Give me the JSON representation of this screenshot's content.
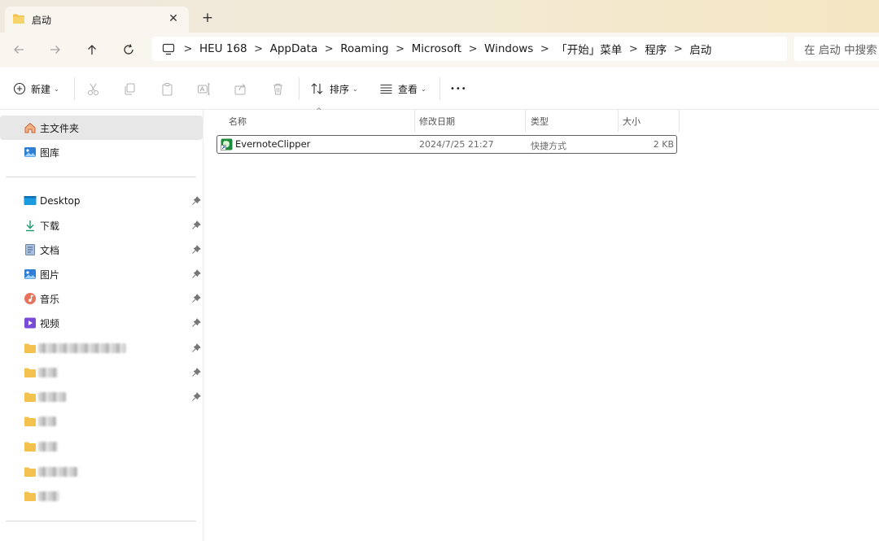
{
  "tab": {
    "title": "启动",
    "close": "✕",
    "new_tab": "+"
  },
  "address": {
    "crumbs": [
      "HEU 168",
      "AppData",
      "Roaming",
      "Microsoft",
      "Windows",
      "「开始」菜单",
      "程序",
      "启动"
    ],
    "separator": ">"
  },
  "search": {
    "placeholder": "在 启动 中搜索"
  },
  "toolbar": {
    "new_label": "新建",
    "sort_label": "排序",
    "view_label": "查看",
    "more": "•••"
  },
  "sidebar": {
    "top": [
      {
        "label": "主文件夹",
        "icon": "home-icon",
        "selected": true
      },
      {
        "label": "图库",
        "icon": "gallery-icon",
        "selected": false
      }
    ],
    "quick_access": [
      {
        "label": "Desktop",
        "icon": "desktop-icon"
      },
      {
        "label": "下载",
        "icon": "download-icon"
      },
      {
        "label": "文档",
        "icon": "document-icon"
      },
      {
        "label": "图片",
        "icon": "pictures-icon"
      },
      {
        "label": "音乐",
        "icon": "music-icon"
      },
      {
        "label": "视频",
        "icon": "video-icon"
      }
    ]
  },
  "columns": {
    "name": "名称",
    "modified": "修改日期",
    "type": "类型",
    "size": "大小"
  },
  "files": [
    {
      "name": "EvernoteClipper",
      "modified": "2024/7/25 21:27",
      "type": "快捷方式",
      "size": "2 KB",
      "icon": "evernote-shortcut-icon"
    }
  ],
  "colors": {
    "titlebar": "#f3ead3",
    "selected": "#e7e7e7",
    "folder": "#f2c14e",
    "accent": "#0067c0"
  }
}
